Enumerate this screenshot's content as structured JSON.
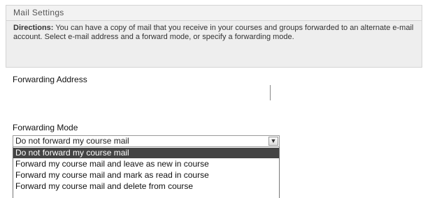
{
  "section": {
    "title": "Mail Settings"
  },
  "directions": {
    "label": "Directions:",
    "text": " You can have a copy of mail that you receive in your courses and groups forwarded to an alternate e-mail account. Select e-mail address and a forward mode, or specify a forwarding mode."
  },
  "forwarding_address": {
    "label": "Forwarding Address"
  },
  "forwarding_mode": {
    "label": "Forwarding Mode",
    "selected_value": "Do not forward my course mail",
    "options": [
      "Do not forward my course mail",
      "Forward my course mail and leave as new in course",
      "Forward my course mail and mark as read in course",
      "Forward my course mail and delete from course"
    ]
  }
}
